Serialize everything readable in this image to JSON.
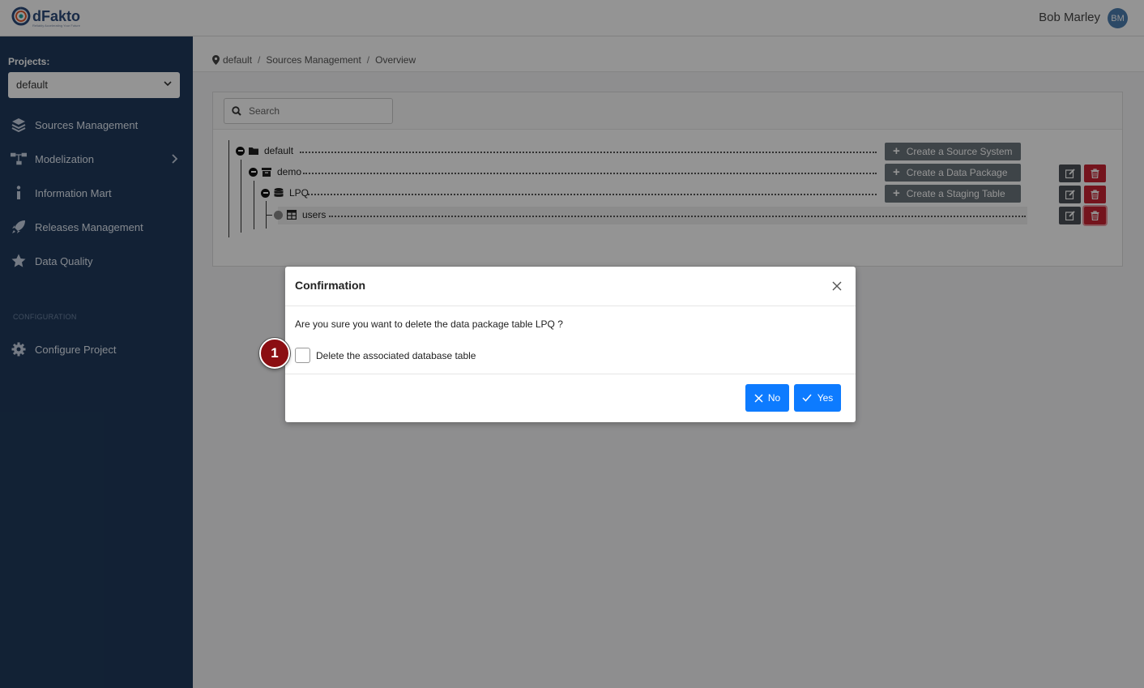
{
  "app": {
    "logo_text": "dFakto",
    "logo_tagline": "Reliably Accelerating Your Future"
  },
  "user": {
    "name": "Bob Marley",
    "initials": "BM"
  },
  "sidebar": {
    "projects_label": "Projects:",
    "project_selected": "default",
    "items": [
      {
        "label": "Sources Management",
        "icon": "layers-icon"
      },
      {
        "label": "Modelization",
        "icon": "sitemap-icon"
      },
      {
        "label": "Information Mart",
        "icon": "info-icon"
      },
      {
        "label": "Releases Management",
        "icon": "rocket-icon"
      },
      {
        "label": "Data Quality",
        "icon": "star-icon"
      }
    ],
    "config_section": "CONFIGURATION",
    "config_items": [
      {
        "label": "Configure Project",
        "icon": "gear-icon"
      }
    ]
  },
  "breadcrumb": [
    "default",
    "Sources Management",
    "Overview"
  ],
  "search": {
    "placeholder": "Search"
  },
  "tree": {
    "nodes": [
      {
        "label": "default",
        "icon": "folder-icon",
        "action": "Create a Source System"
      },
      {
        "label": "demo",
        "icon": "archive-icon",
        "action": "Create a Data Package"
      },
      {
        "label": "LPQ",
        "icon": "database-icon",
        "action": "Create a Staging Table"
      },
      {
        "label": "users",
        "icon": "table-icon"
      }
    ]
  },
  "modal": {
    "title": "Confirmation",
    "message": "Are you sure you want to delete the data package table LPQ ?",
    "checkbox_label": "Delete the associated database table",
    "checkbox_checked": false,
    "no_label": "No",
    "yes_label": "Yes"
  },
  "step_badge": "1",
  "colors": {
    "sidebar_bg": "#1f3a5c",
    "primary": "#0d7bff",
    "danger": "#c82333",
    "secondary": "#6c757d",
    "badge": "#8b0e12"
  }
}
